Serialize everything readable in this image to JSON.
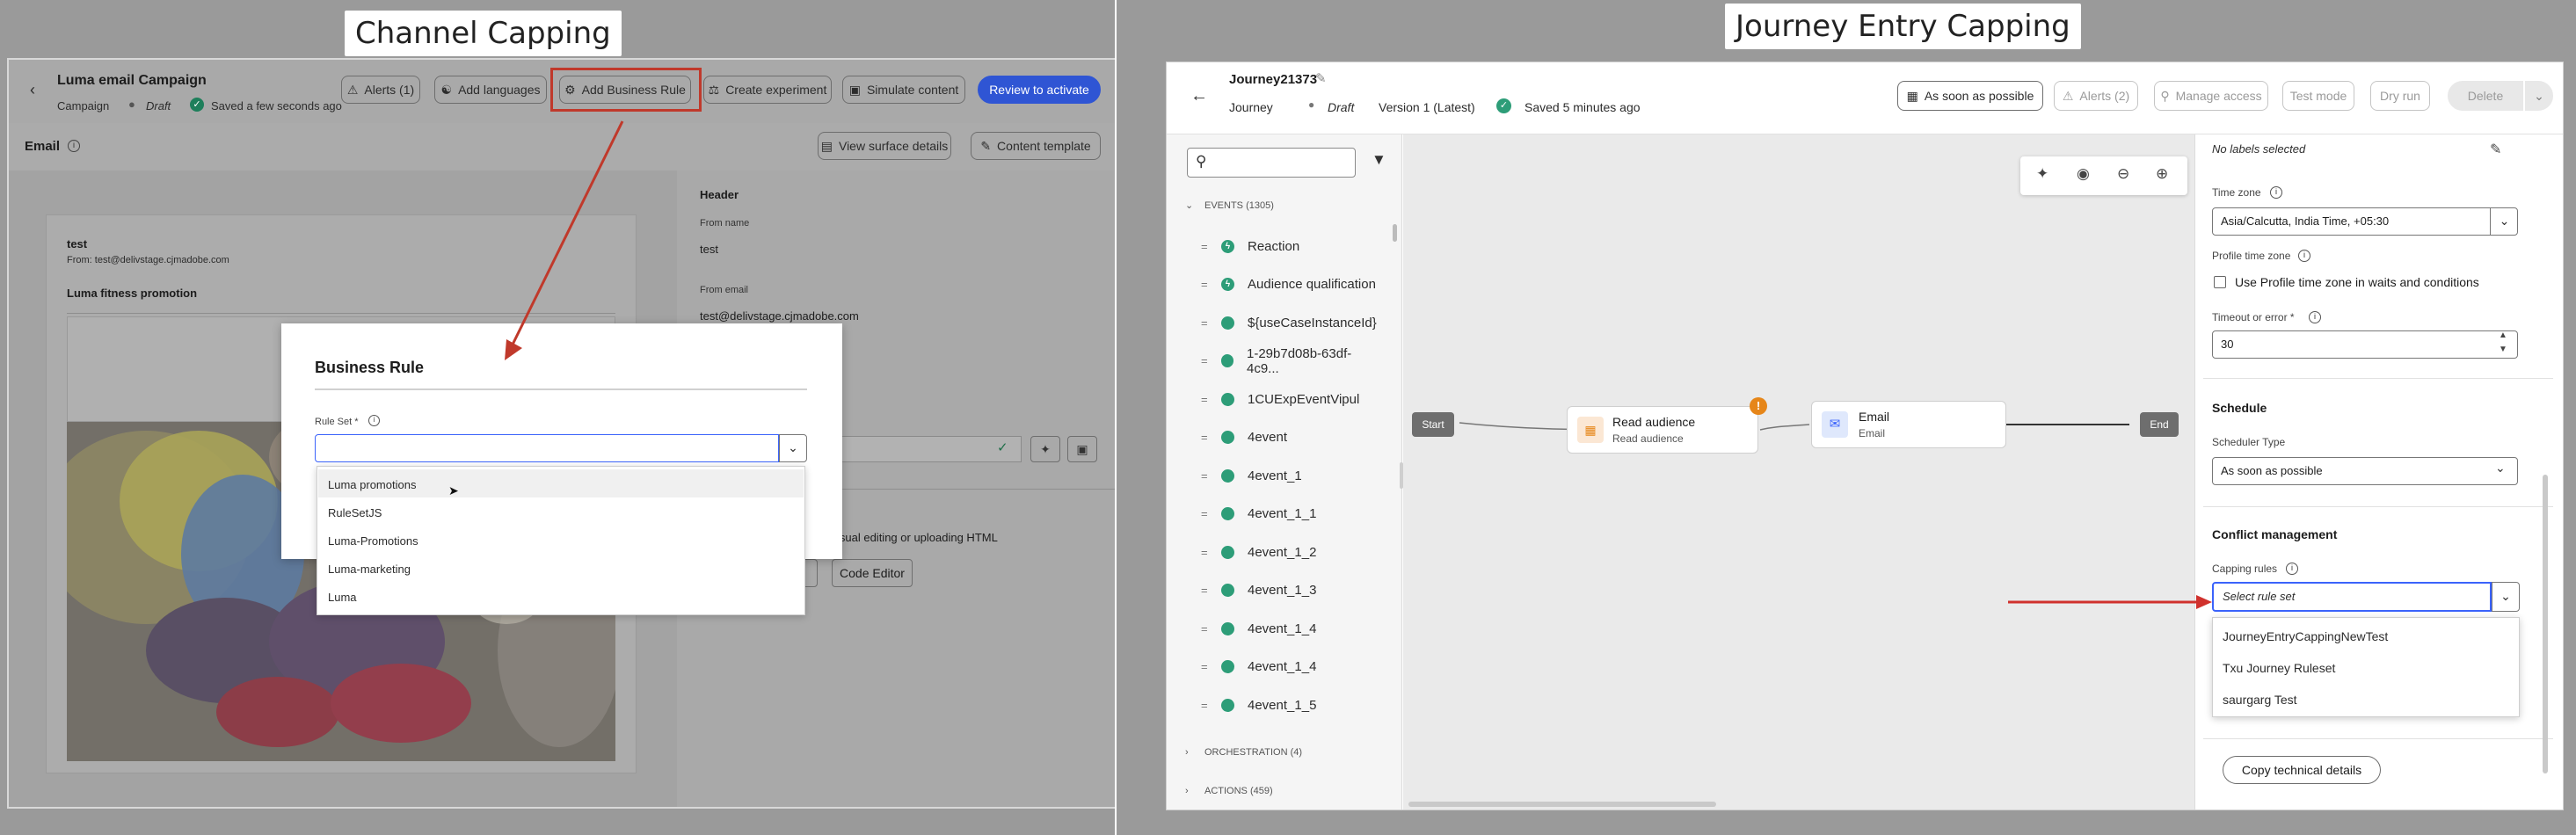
{
  "captions": {
    "left": "Channel Capping",
    "right": "Journey Entry Capping"
  },
  "left": {
    "campaign_name": "Luma email Campaign",
    "campaign_type": "Campaign",
    "status": "Draft",
    "saved": "Saved a few seconds ago",
    "toolbar": {
      "alerts": "Alerts (1)",
      "add_languages": "Add languages",
      "add_business_rule": "Add Business Rule",
      "create_experiment": "Create experiment",
      "simulate_content": "Simulate content",
      "review_to_activate": "Review to activate"
    },
    "section_title": "Email",
    "view_surface_details": "View surface details",
    "content_template": "Content template",
    "preview": {
      "subject": "test",
      "from": "From: test@delivstage.cjmadobe.com",
      "headline": "Luma fitness promotion"
    },
    "header_panel": {
      "title": "Header",
      "from_name_label": "From name",
      "from_name_value": "test",
      "from_email_label": "From email",
      "from_email_value": "test@delivstage.cjmadobe.com",
      "design_text": "isual editing or uploading HTML",
      "code_editor": "Code Editor"
    },
    "modal": {
      "title": "Business Rule",
      "rule_set_label": "Rule Set",
      "options": [
        "Luma promotions",
        "RuleSetJS",
        "Luma-Promotions",
        "Luma-marketing",
        "Luma"
      ]
    }
  },
  "right": {
    "journey_name": "Journey21373",
    "journey_type": "Journey",
    "status": "Draft",
    "version": "Version 1 (Latest)",
    "saved": "Saved 5 minutes ago",
    "toolbar": {
      "as_soon_as_possible": "As soon as possible",
      "alerts": "Alerts (2)",
      "manage_access": "Manage access",
      "test_mode": "Test mode",
      "dry_run": "Dry run",
      "delete": "Delete"
    },
    "events_header": "EVENTS (1305)",
    "events": [
      "Reaction",
      "Audience qualification",
      "${useCaseInstanceId}",
      "1-29b7d08b-63df-4c9...",
      "1CUExpEventVipul",
      "4event",
      "4event_1",
      "4event_1_1",
      "4event_1_2",
      "4event_1_3",
      "4event_1_4",
      "4event_1_4",
      "4event_1_5"
    ],
    "orchestration_header": "ORCHESTRATION (4)",
    "actions_header": "ACTIONS (459)",
    "canvas": {
      "start": "Start",
      "read_audience_title": "Read audience",
      "read_audience_sub": "Read audience",
      "email_title": "Email",
      "email_sub": "Email",
      "end": "End"
    },
    "props": {
      "labels_text": "No labels selected",
      "time_zone_label": "Time zone",
      "time_zone_value": "Asia/Calcutta, India Time, +05:30",
      "profile_tz_label": "Profile time zone",
      "profile_tz_checkbox": "Use Profile time zone in waits and conditions",
      "timeout_label": "Timeout or error",
      "timeout_value": "30",
      "schedule_title": "Schedule",
      "scheduler_type_label": "Scheduler Type",
      "scheduler_type_value": "As soon as possible",
      "conflict_title": "Conflict management",
      "capping_rules_label": "Capping rules",
      "capping_placeholder": "Select rule set",
      "capping_options": [
        "JourneyEntryCappingNewTest",
        "Txu Journey Ruleset",
        "saurgarg Test"
      ],
      "copy_technical_details": "Copy technical details"
    }
  },
  "colors": {
    "accent_blue": "#3b63fb",
    "red_arrow": "#c0392b",
    "green": "#2d9d78",
    "orange": "#e68619"
  }
}
